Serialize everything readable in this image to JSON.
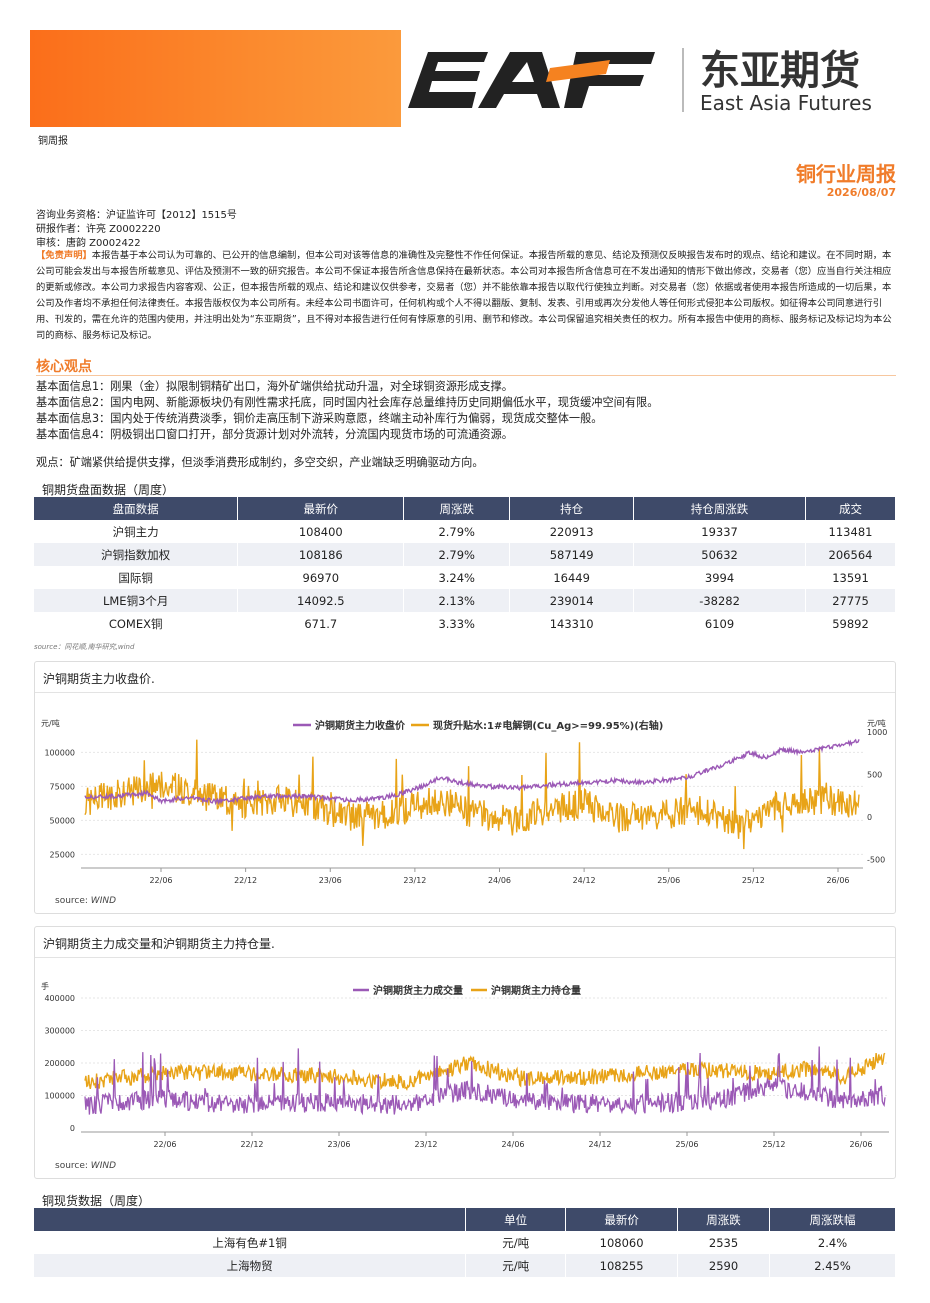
{
  "header": {
    "brand_mark": "EAF",
    "brand_cn": "东亚期货",
    "brand_en": "East Asia Futures",
    "doc_tag": "铜周报",
    "report_title": "铜行业周报",
    "report_date": "2026/08/07"
  },
  "meta": {
    "qualification": "咨询业务资格：沪证监许可【2012】1515号",
    "author": "研报作者：许亮 Z0002220",
    "reviewer": "审核：唐韵 Z0002422"
  },
  "disclaimer": {
    "tag": "【免责声明】",
    "text": "本报告基于本公司认为可靠的、已公开的信息编制，但本公司对该等信息的准确性及完整性不作任何保证。本报告所载的意见、结论及预测仅反映报告发布时的观点、结论和建议。在不同时期，本公司可能会发出与本报告所载意见、评估及预测不一致的研究报告。本公司不保证本报告所含信息保持在最新状态。本公司对本报告所含信息可在不发出通知的情形下做出修改，交易者（您）应当自行关注相应的更新或修改。本公司力求报告内容客观、公正，但本报告所载的观点、结论和建议仅供参考，交易者（您）并不能依靠本报告以取代行使独立判断。对交易者（您）依据或者使用本报告所造成的一切后果，本公司及作者均不承担任何法律责任。本报告版权仅为本公司所有。未经本公司书面许可，任何机构或个人不得以翻版、复制、发表、引用或再次分发他人等任何形式侵犯本公司版权。如征得本公司同意进行引用、刊发的，需在允许的范围内使用，并注明出处为“东亚期货”，且不得对本报告进行任何有悖原意的引用、删节和修改。本公司保留追究相关责任的权力。所有本报告中使用的商标、服务标记及标记均为本公司的商标、服务标记及标记。"
  },
  "core": {
    "title": "核心观点",
    "info": [
      "基本面信息1：刚果（金）拟限制铜精矿出口，海外矿端供给扰动升温，对全球铜资源形成支撑。",
      "基本面信息2：国内电网、新能源板块仍有刚性需求托底，同时国内社会库存总量维持历史同期偏低水平，现货缓冲空间有限。",
      "基本面信息3：国内处于传统消费淡季，铜价走高压制下游采购意愿，终端主动补库行为偏弱，现货成交整体一般。",
      "基本面信息4：阴极铜出口窗口打开，部分货源计划对外流转，分流国内现货市场的可流通资源。"
    ],
    "view": "观点：矿端紧供给提供支撑，但淡季消费形成制约，多空交织，产业端缺乏明确驱动方向。"
  },
  "futures_table": {
    "title": "铜期货盘面数据（周度）",
    "headers": [
      "盘面数据",
      "最新价",
      "周涨跌",
      "持仓",
      "持仓周涨跌",
      "成交"
    ],
    "rows": [
      [
        "沪铜主力",
        "108400",
        "2.79%",
        "220913",
        "19337",
        "113481"
      ],
      [
        "沪铜指数加权",
        "108186",
        "2.79%",
        "587149",
        "50632",
        "206564"
      ],
      [
        "国际铜",
        "96970",
        "3.24%",
        "16449",
        "3994",
        "13591"
      ],
      [
        "LME铜3个月",
        "14092.5",
        "2.13%",
        "239014",
        "-38282",
        "27775"
      ],
      [
        "COMEX铜",
        "671.7",
        "3.33%",
        "143310",
        "6109",
        "59892"
      ]
    ],
    "source": "source：同花顺,南华研究,wind"
  },
  "chart1": {
    "title": "沪铜期货主力收盘价.",
    "source_label": "source:",
    "source_name": "WIND",
    "colors": {
      "price": "#9b59b6",
      "basis": "#e8a317"
    },
    "chart_data": {
      "type": "line",
      "series": [
        {
          "name": "沪铜期货主力收盘价",
          "axis": "left"
        },
        {
          "name": "现货升贴水:1#电解铜(Cu_Ag>=99.95%)(右轴)",
          "axis": "right"
        }
      ],
      "x_ticks": [
        "22/06",
        "22/12",
        "23/06",
        "23/12",
        "24/06",
        "24/12",
        "25/06",
        "25/12",
        "26/06"
      ],
      "ylabel_left": "元/吨",
      "ylabel_right": "元/吨",
      "yticks_left": [
        "100000",
        "75000",
        "50000",
        "25000"
      ],
      "yticks_right": [
        "1000",
        "500",
        "0",
        "-500"
      ],
      "ylim_left": [
        15000,
        115000
      ],
      "ylim_right": [
        -600,
        1000
      ],
      "price_path": [
        [
          0,
          67000
        ],
        [
          4,
          68000
        ],
        [
          8,
          70000
        ],
        [
          10,
          64000
        ],
        [
          13,
          67000
        ],
        [
          17,
          64000
        ],
        [
          20,
          66000
        ],
        [
          24,
          68000
        ],
        [
          28,
          68000
        ],
        [
          30,
          67000
        ],
        [
          34,
          65000
        ],
        [
          38,
          66000
        ],
        [
          41,
          70000
        ],
        [
          44,
          76000
        ],
        [
          46,
          82000
        ],
        [
          48,
          78000
        ],
        [
          52,
          75000
        ],
        [
          56,
          74000
        ],
        [
          60,
          76000
        ],
        [
          65,
          78000
        ],
        [
          68,
          79000
        ],
        [
          72,
          78000
        ],
        [
          76,
          80000
        ],
        [
          78,
          82000
        ],
        [
          80,
          86000
        ],
        [
          82,
          90000
        ],
        [
          84,
          95000
        ],
        [
          86,
          100000
        ],
        [
          88,
          96000
        ],
        [
          90,
          102000
        ],
        [
          93,
          100000
        ],
        [
          96,
          104000
        ],
        [
          100,
          108400
        ]
      ],
      "basis_level": [
        [
          0,
          180
        ],
        [
          10,
          400
        ],
        [
          15,
          250
        ],
        [
          20,
          150
        ],
        [
          25,
          200
        ],
        [
          30,
          100
        ],
        [
          35,
          0
        ],
        [
          40,
          50
        ],
        [
          45,
          200
        ],
        [
          50,
          50
        ],
        [
          55,
          -50
        ],
        [
          60,
          100
        ],
        [
          65,
          150
        ],
        [
          68,
          0
        ],
        [
          72,
          -20
        ],
        [
          75,
          50
        ],
        [
          80,
          100
        ],
        [
          85,
          -100
        ],
        [
          90,
          150
        ],
        [
          95,
          200
        ],
        [
          100,
          150
        ]
      ]
    }
  },
  "chart2": {
    "title": "沪铜期货主力成交量和沪铜期货主力持仓量.",
    "source_label": "source:",
    "source_name": "WIND",
    "colors": {
      "volume": "#9b59b6",
      "oi": "#e8a317"
    },
    "chart_data": {
      "type": "line",
      "series": [
        {
          "name": "沪铜期货主力成交量"
        },
        {
          "name": "沪铜期货主力持仓量"
        }
      ],
      "x_ticks": [
        "22/06",
        "22/12",
        "23/06",
        "23/12",
        "24/06",
        "24/12",
        "25/06",
        "25/12",
        "26/06"
      ],
      "ylabel": "手",
      "yticks": [
        "400000",
        "300000",
        "200000",
        "100000",
        "0"
      ],
      "ylim": [
        0,
        400000
      ],
      "volume_level": [
        [
          0,
          70000
        ],
        [
          10,
          90000
        ],
        [
          20,
          70000
        ],
        [
          30,
          80000
        ],
        [
          40,
          70000
        ],
        [
          48,
          120000
        ],
        [
          55,
          80000
        ],
        [
          65,
          70000
        ],
        [
          75,
          80000
        ],
        [
          80,
          90000
        ],
        [
          85,
          130000
        ],
        [
          90,
          110000
        ],
        [
          95,
          80000
        ],
        [
          100,
          100000
        ]
      ],
      "oi_level": [
        [
          0,
          140000
        ],
        [
          10,
          170000
        ],
        [
          20,
          170000
        ],
        [
          30,
          160000
        ],
        [
          40,
          140000
        ],
        [
          48,
          200000
        ],
        [
          55,
          150000
        ],
        [
          65,
          160000
        ],
        [
          75,
          180000
        ],
        [
          85,
          170000
        ],
        [
          90,
          180000
        ],
        [
          95,
          160000
        ],
        [
          100,
          220913
        ]
      ]
    }
  },
  "spot_table": {
    "title": "铜现货数据（周度）",
    "headers": [
      "",
      "单位",
      "最新价",
      "周涨跌",
      "周涨跌幅"
    ],
    "rows": [
      [
        "上海有色#1铜",
        "元/吨",
        "108060",
        "2535",
        "2.4%"
      ],
      [
        "上海物贸",
        "元/吨",
        "108255",
        "2590",
        "2.45%"
      ]
    ]
  }
}
